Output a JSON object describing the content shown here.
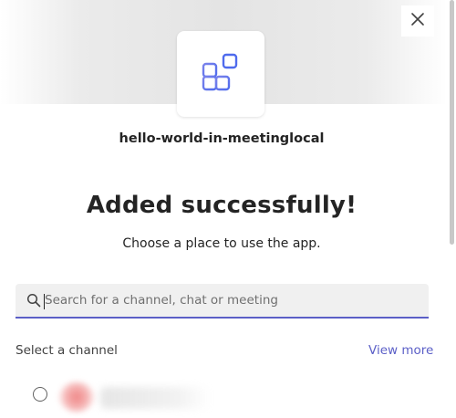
{
  "dialog": {
    "close_icon": "close-icon",
    "app_icon": "apps-grid-icon",
    "app_name": "hello-world-in-meetinglocal",
    "headline": "Added successfully!",
    "subtitle": "Choose a place to use the app."
  },
  "search": {
    "placeholder": "Search for a channel, chat or meeting",
    "value": "",
    "icon": "search-icon"
  },
  "channels": {
    "section_label": "Select a channel",
    "view_more_label": "View more"
  },
  "colors": {
    "accent": "#5b5fc7",
    "text": "#242424",
    "search_bg": "#f0f0f0"
  }
}
